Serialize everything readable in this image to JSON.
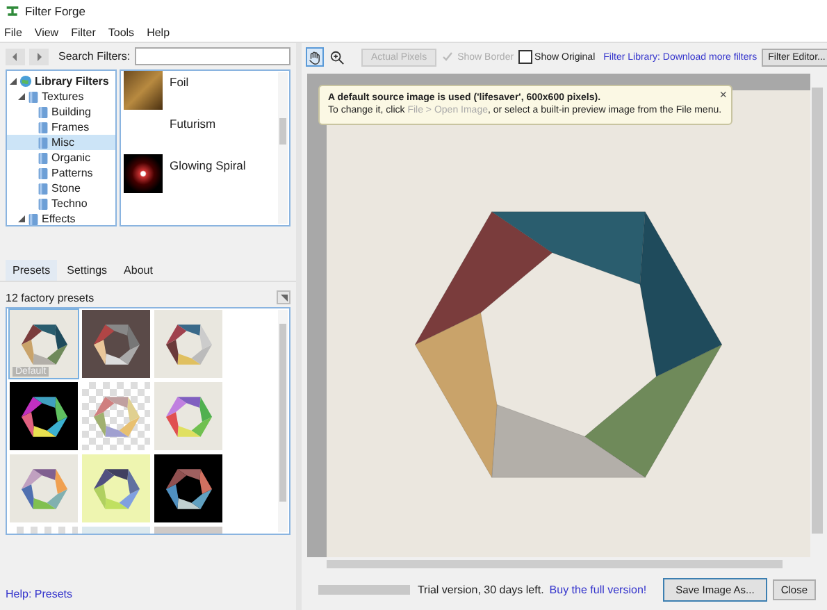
{
  "window": {
    "title": "Filter Forge"
  },
  "menu": [
    "File",
    "View",
    "Filter",
    "Tools",
    "Help"
  ],
  "search": {
    "label": "Search Filters:"
  },
  "tree": [
    {
      "label": "Library Filters",
      "expanded": true,
      "selected": false,
      "children": [
        {
          "label": "Textures",
          "expanded": true,
          "selected": false,
          "children": [
            {
              "label": "Building",
              "selected": false
            },
            {
              "label": "Frames",
              "selected": false
            },
            {
              "label": "Misc",
              "selected": true
            },
            {
              "label": "Organic",
              "selected": false
            },
            {
              "label": "Patterns",
              "selected": false
            },
            {
              "label": "Stone",
              "selected": false
            },
            {
              "label": "Techno",
              "selected": false
            }
          ]
        },
        {
          "label": "Effects",
          "expanded": true,
          "selected": false
        }
      ]
    }
  ],
  "filters": [
    {
      "name": "Foil",
      "kind": "foil"
    },
    {
      "name": "Futurism",
      "kind": "blank"
    },
    {
      "name": "Glowing Spiral",
      "kind": "spiral"
    }
  ],
  "tabs": [
    {
      "label": "Presets",
      "selected": true
    },
    {
      "label": "Settings",
      "selected": false
    },
    {
      "label": "About",
      "selected": false
    }
  ],
  "presets_count": "12 factory presets",
  "presets": [
    {
      "label": "Default",
      "kind": "light",
      "selected": true
    },
    {
      "kind": "brown",
      "selected": false
    },
    {
      "kind": "light",
      "selected": false
    },
    {
      "kind": "black",
      "selected": false
    },
    {
      "kind": "checker",
      "selected": false
    },
    {
      "kind": "light",
      "selected": false
    },
    {
      "kind": "light",
      "selected": false
    },
    {
      "kind": "lime",
      "selected": false
    },
    {
      "kind": "black",
      "selected": false
    },
    {
      "kind": "checker",
      "selected": false
    },
    {
      "kind": "pale",
      "selected": false
    },
    {
      "kind": "gray",
      "selected": false
    }
  ],
  "help_link": "Help: Presets",
  "toolbar": {
    "tools": [
      {
        "kind": "hand",
        "selected": true
      },
      {
        "kind": "zoom",
        "selected": false
      }
    ],
    "actual_pixels": {
      "label": "Actual Pixels",
      "disabled": true
    },
    "show_border": {
      "label": "Show Border",
      "checked": true,
      "disabled": true
    },
    "show_original": {
      "label": "Show Original",
      "checked": false,
      "disabled": false
    },
    "library_link": "Filter Library: Download more filters",
    "editor_button": "Filter Editor..."
  },
  "notice": {
    "line1": "A default source image is used ('lifesaver', 600x600 pixels).",
    "line2_before": "To change it, click ",
    "line2_link": "File > Open Image",
    "line2_after": ", or select a built-in preview image from the File menu.",
    "close": "×"
  },
  "status": {
    "progress": {
      "level": 0
    },
    "trial": "Trial version, 30 days left.",
    "buy_link": "Buy the full version!",
    "save_button": "Save Image As...",
    "close_button": "Close"
  }
}
